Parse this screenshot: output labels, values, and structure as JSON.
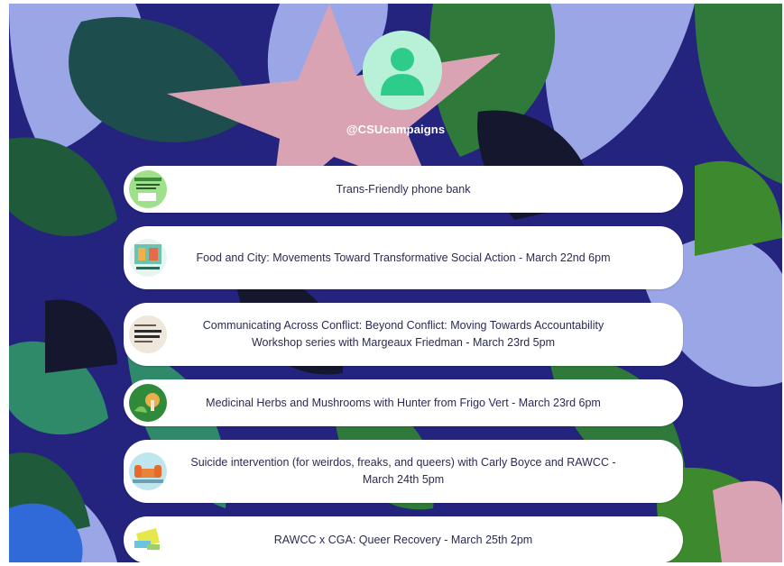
{
  "profile": {
    "handle": "@CSUcampaigns",
    "avatar_icon": "user-silhouette-icon",
    "avatar_bg": "#b8f0d8",
    "avatar_fg": "#2ecc8a"
  },
  "links": [
    {
      "title": "Trans-Friendly phone bank"
    },
    {
      "title": "Food and City: Movements Toward Transformative Social Action - March 22nd 6pm"
    },
    {
      "title": "Communicating Across Conflict: Beyond Conflict: Moving Towards Accountability Workshop series with Margeaux Friedman - March 23rd 5pm"
    },
    {
      "title": "Medicinal Herbs and Mushrooms with Hunter from Frigo Vert - March 23rd 6pm"
    },
    {
      "title": "Suicide intervention (for weirdos, freaks, and queers) with Carly Boyce and RAWCC - March 24th 5pm"
    },
    {
      "title": "RAWCC x CGA: Queer Recovery - March 25th 2pm"
    }
  ],
  "colors": {
    "background_indigo": "#2a2a8a",
    "leaf_green": "#2f7a3a",
    "leaf_teal": "#2f8a6a",
    "leaf_lavender": "#9aa6e6",
    "star_pink": "#d9a3b3",
    "link_text": "#2b2b52"
  }
}
